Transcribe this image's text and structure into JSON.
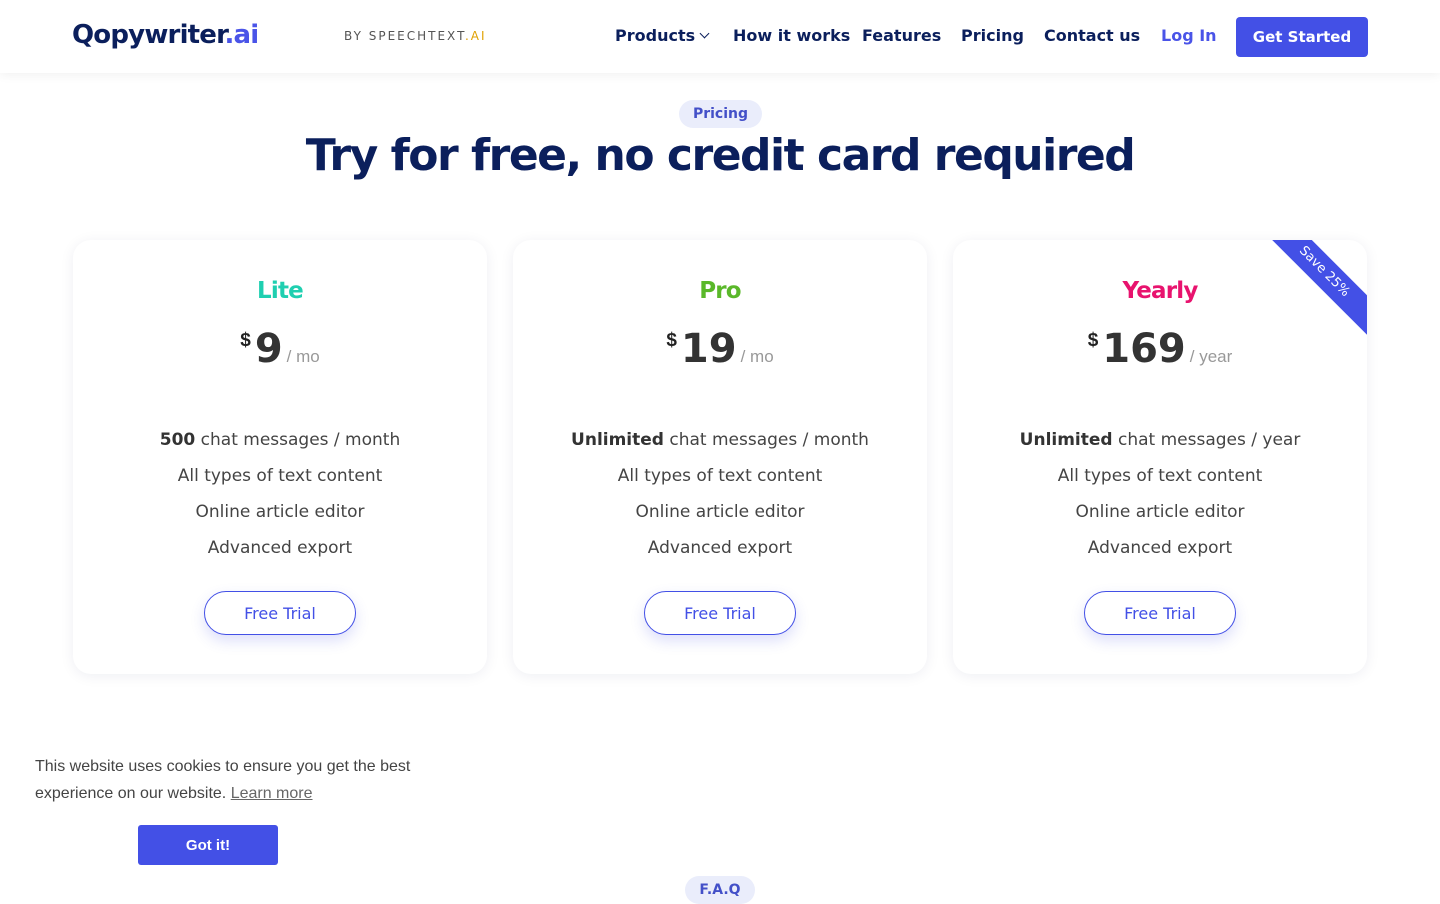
{
  "header": {
    "logo_main": "Qopywriter",
    "logo_suffix": ".ai",
    "byline_main": "BY SPEECHTEXT",
    "byline_suffix": ".AI",
    "nav": {
      "products": "Products",
      "how_it_works": "How it works",
      "features": "Features",
      "pricing": "Pricing",
      "contact": "Contact us",
      "login": "Log In"
    },
    "cta": "Get Started"
  },
  "pricing_section": {
    "tag": "Pricing",
    "headline": "Try for free, no credit card required"
  },
  "plans": [
    {
      "name": "Lite",
      "name_color": "#1fcfb0",
      "currency": "$",
      "amount": "9",
      "period": "/ mo",
      "feature_1_bold": "500",
      "feature_1_rest": " chat messages / month",
      "feature_2": "All types of text content",
      "feature_3": "Online article editor",
      "feature_4": "Advanced export",
      "button": "Free Trial"
    },
    {
      "name": "Pro",
      "name_color": "#5ab82a",
      "currency": "$",
      "amount": "19",
      "period": "/ mo",
      "feature_1_bold": "Unlimited",
      "feature_1_rest": " chat messages / month",
      "feature_2": "All types of text content",
      "feature_3": "Online article editor",
      "feature_4": "Advanced export",
      "button": "Free Trial"
    },
    {
      "name": "Yearly",
      "name_color": "#e8136e",
      "currency": "$",
      "amount": "169",
      "period": "/ year",
      "feature_1_bold": "Unlimited",
      "feature_1_rest": " chat messages / year",
      "feature_2": "All types of text content",
      "feature_3": "Online article editor",
      "feature_4": "Advanced export",
      "button": "Free Trial",
      "ribbon": "Save 25%"
    }
  ],
  "cookie": {
    "message": "This website uses cookies to ensure you get the best experience on our website.",
    "learn_more": "Learn more",
    "accept": "Got it!"
  },
  "faq_section": {
    "tag": "F.A.Q"
  },
  "colors": {
    "primary": "#4350e6",
    "navy": "#0b1f5c"
  }
}
